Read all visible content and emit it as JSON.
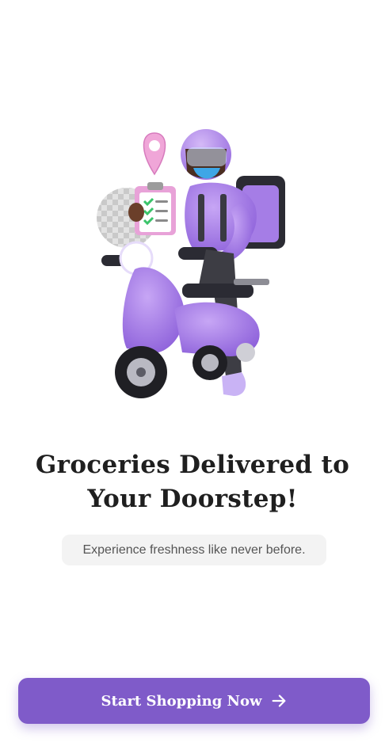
{
  "onboarding": {
    "illustration": "delivery-rider-scooter-illustration",
    "title_line1": "Groceries Delivered to",
    "title_line2": "Your Doorstep!",
    "subtitle": "Experience freshness like never before.",
    "cta_label": "Start Shopping Now",
    "cta_icon": "arrow-right-icon"
  },
  "colors": {
    "accent": "#7f5bc9",
    "title": "#1f1f1f",
    "subtitle_text": "#555555",
    "subtitle_bg": "#f3f3f3",
    "background": "#ffffff"
  }
}
